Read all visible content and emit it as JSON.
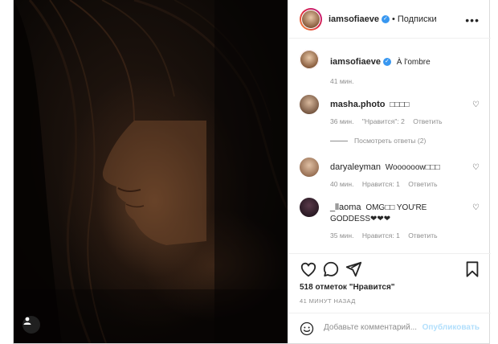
{
  "header": {
    "username": "iamsofiaeve",
    "separator": "•",
    "follow_label": "Подписки",
    "more_icon": "more-options-icon"
  },
  "caption": {
    "username": "iamsofiaeve",
    "text": "À l'ombre",
    "time": "41 мин."
  },
  "comments": [
    {
      "username": "masha.photo",
      "text": "□□□□",
      "time": "36 мин.",
      "likes": "\"Нравится\": 2",
      "reply": "Ответить"
    },
    {
      "username": "daryaleyman",
      "text": "Woooooow□□□",
      "time": "40 мин.",
      "likes": "Нравится: 1",
      "reply": "Ответить"
    },
    {
      "username": "_llaoma",
      "text": "OMG□□ YOU'RE GODDESS❤❤❤",
      "time": "35 мин.",
      "likes": "Нравится: 1",
      "reply": "Ответить"
    }
  ],
  "view_replies": "Посмотреть ответы (2)",
  "likes_text": "518 отметок \"Нравится\"",
  "posted_ago": "41 МИНУТ НАЗАД",
  "add_comment": {
    "placeholder": "Добавьте комментарий...",
    "publish_label": "Опубликовать"
  },
  "colors": {
    "link_blue": "#3897f0",
    "publish_disabled": "#b2dffc",
    "muted": "#8e8e8e"
  }
}
